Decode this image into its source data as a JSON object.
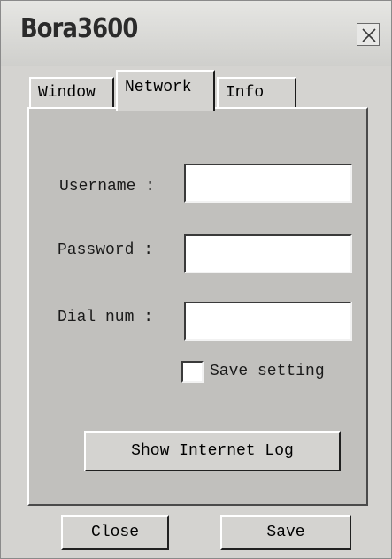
{
  "window": {
    "title": "Bora3600"
  },
  "tabs": [
    {
      "label": "Window"
    },
    {
      "label": "Network",
      "active": true
    },
    {
      "label": "Info"
    }
  ],
  "form": {
    "username": {
      "label": "Username :",
      "value": ""
    },
    "password": {
      "label": "Password :",
      "value": ""
    },
    "dial_num": {
      "label": "Dial num :",
      "value": ""
    },
    "save_setting": {
      "label": "Save setting",
      "checked": false
    },
    "show_log_label": "Show Internet Log"
  },
  "footer": {
    "close_label": "Close",
    "save_label": "Save"
  },
  "icons": {
    "close": "close-icon"
  },
  "colors": {
    "window_bg": "#d4d3d0",
    "panel_bg": "#c1c0bd",
    "field_bg": "#ffffff"
  }
}
